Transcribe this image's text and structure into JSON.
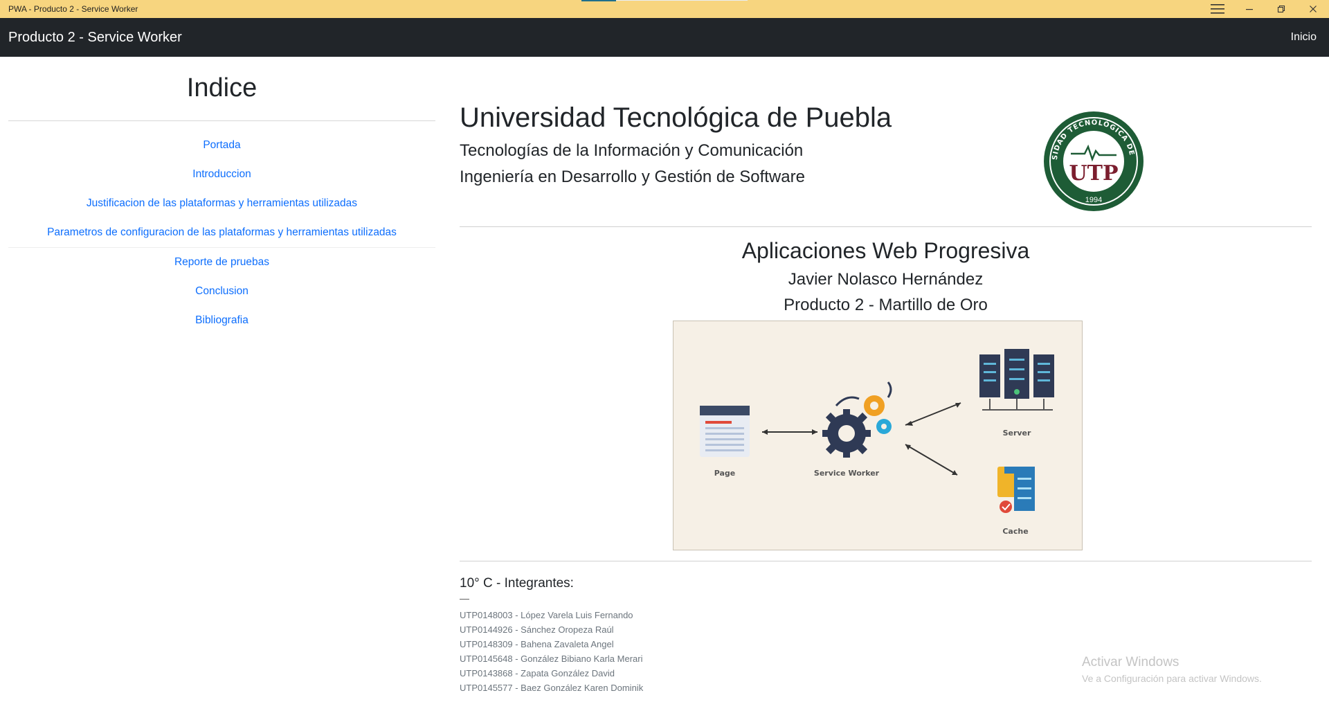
{
  "window": {
    "title": "PWA - Producto 2 - Service Worker",
    "controls": [
      "menu-icon",
      "minimize-icon",
      "restore-icon",
      "close-icon"
    ]
  },
  "navbar": {
    "brand": "Producto 2 - Service Worker",
    "link": "Inicio"
  },
  "sidebar": {
    "heading": "Indice",
    "items": [
      {
        "label": "Portada"
      },
      {
        "label": "Introduccion"
      },
      {
        "label": "Justificacion de las plataformas y herramientas utilizadas"
      },
      {
        "label": "Parametros de configuracion de las plataformas y herramientas utilizadas"
      },
      {
        "label": "Reporte de pruebas"
      },
      {
        "label": "Conclusion"
      },
      {
        "label": "Bibliografia"
      }
    ]
  },
  "header": {
    "university": "Universidad Tecnológica de Puebla",
    "division": "Tecnologías de la Información y Comunicación",
    "career": "Ingeniería en Desarrollo y Gestión de Software",
    "logo": {
      "arc_text": "UNIVERSIDAD TECNOLÓGICA DE PUEBLA",
      "initials": "UTP",
      "year": "1994"
    }
  },
  "course": {
    "title": "Aplicaciones Web Progresiva",
    "teacher": "Javier Nolasco Hernández",
    "product": "Producto 2 - Martillo de Oro"
  },
  "diagram": {
    "labels": {
      "page": "Page",
      "worker": "Service Worker",
      "server": "Server",
      "cache": "Cache"
    }
  },
  "team": {
    "title": "10° C - Integrantes:",
    "dash": "—",
    "members": [
      "UTP0148003 - López Varela Luis Fernando",
      "UTP0144926 - Sánchez Oropeza Raúl",
      "UTP0148309 - Bahena Zavaleta Angel",
      "UTP0145648 - González Bibiano Karla Merari",
      "UTP0143868 - Zapata González David",
      "UTP0145577 - Baez González Karen Dominik"
    ]
  },
  "watermark": {
    "line1": "Activar Windows",
    "line2": "Ve a Configuración para activar Windows."
  }
}
